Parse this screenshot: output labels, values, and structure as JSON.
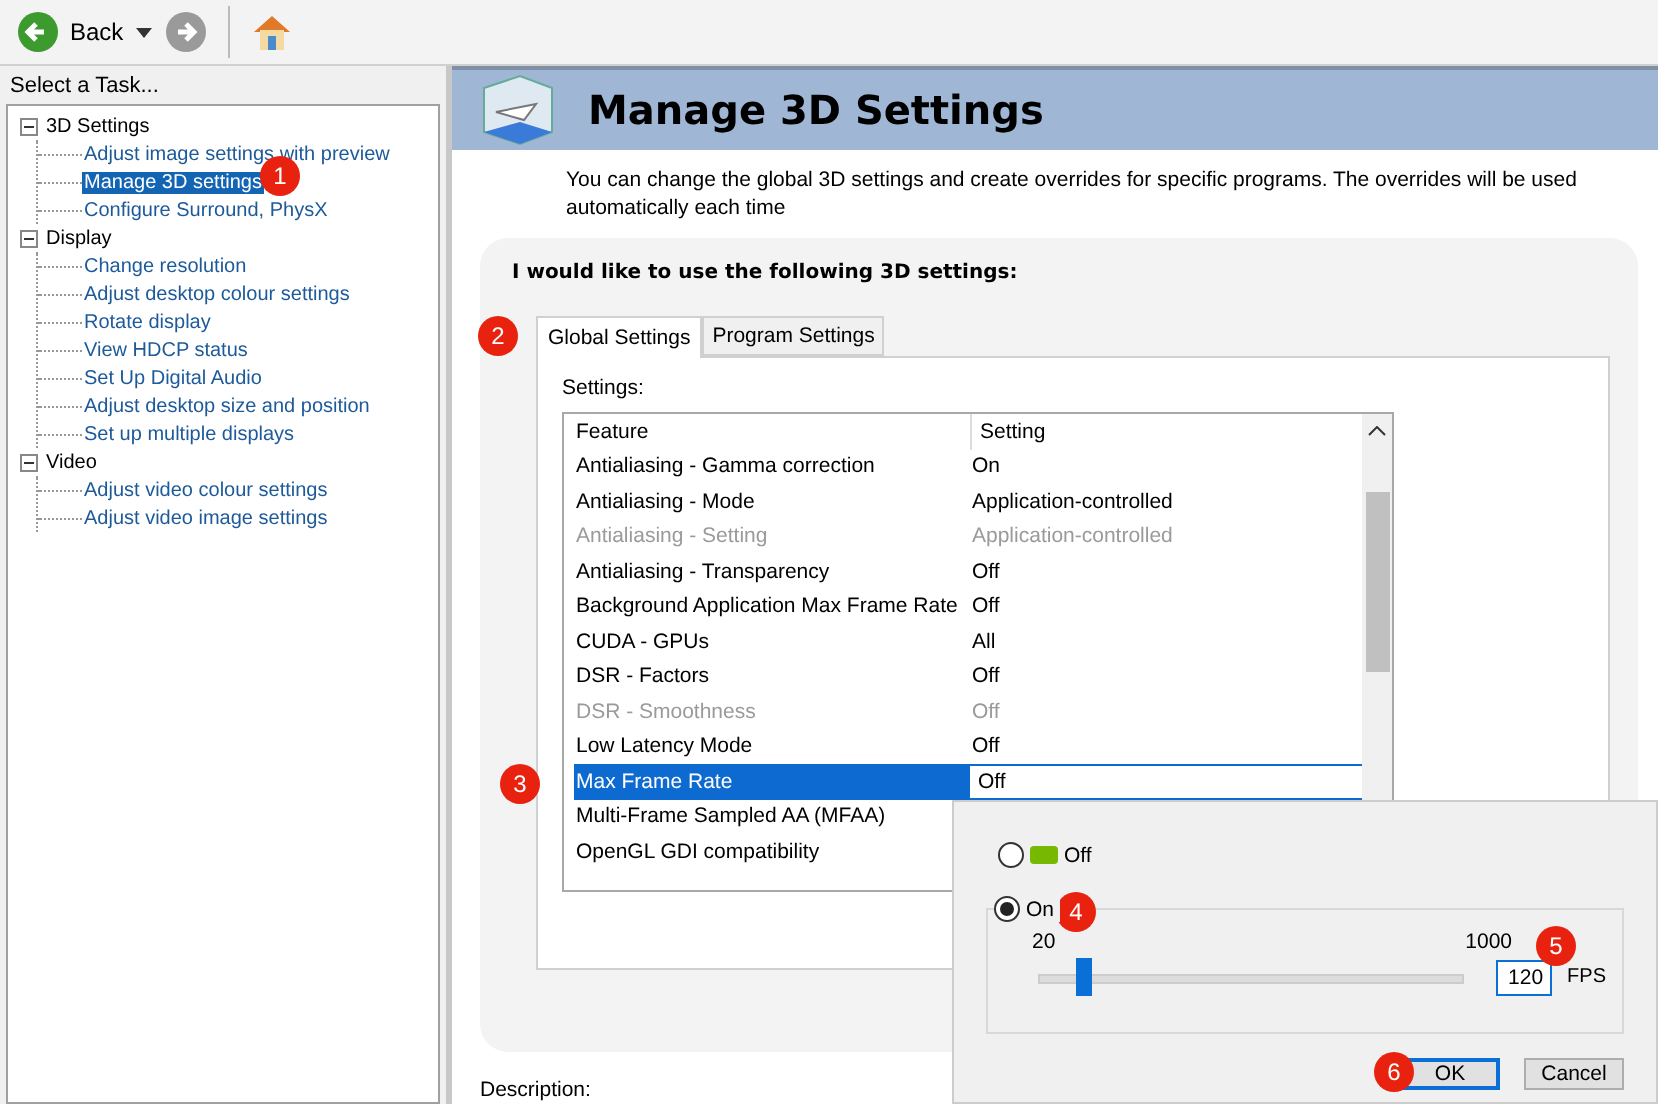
{
  "toolbar": {
    "back_label": "Back"
  },
  "sidebar": {
    "header": "Select a Task...",
    "tree": [
      {
        "label": "3D Settings",
        "expanded": true,
        "children": [
          {
            "label": "Adjust image settings with preview",
            "selected": false
          },
          {
            "label": "Manage 3D settings",
            "selected": true
          },
          {
            "label": "Configure Surround, PhysX",
            "selected": false
          }
        ]
      },
      {
        "label": "Display",
        "expanded": true,
        "children": [
          {
            "label": "Change resolution",
            "selected": false
          },
          {
            "label": "Adjust desktop colour settings",
            "selected": false
          },
          {
            "label": "Rotate display",
            "selected": false
          },
          {
            "label": "View HDCP status",
            "selected": false
          },
          {
            "label": "Set Up Digital Audio",
            "selected": false
          },
          {
            "label": "Adjust desktop size and position",
            "selected": false
          },
          {
            "label": "Set up multiple displays",
            "selected": false
          }
        ]
      },
      {
        "label": "Video",
        "expanded": true,
        "children": [
          {
            "label": "Adjust video colour settings",
            "selected": false
          },
          {
            "label": "Adjust video image settings",
            "selected": false
          }
        ]
      }
    ]
  },
  "page": {
    "title": "Manage 3D Settings",
    "intro": "You can change the global 3D settings and create overrides for specific programs. The overrides will be used automatically each time",
    "heading": "I would like to use the following 3D settings:",
    "tabs": [
      {
        "label": "Global Settings",
        "selected": true
      },
      {
        "label": "Program Settings",
        "selected": false
      }
    ],
    "settings_label": "Settings:",
    "table": {
      "columns": [
        "Feature",
        "Setting"
      ],
      "rows": [
        {
          "feature": "Antialiasing - Gamma correction",
          "setting": "On",
          "disabled": false,
          "selected": false
        },
        {
          "feature": "Antialiasing - Mode",
          "setting": "Application-controlled",
          "disabled": false,
          "selected": false
        },
        {
          "feature": "Antialiasing - Setting",
          "setting": "Application-controlled",
          "disabled": true,
          "selected": false
        },
        {
          "feature": "Antialiasing - Transparency",
          "setting": "Off",
          "disabled": false,
          "selected": false
        },
        {
          "feature": "Background Application Max Frame Rate",
          "setting": "Off",
          "disabled": false,
          "selected": false
        },
        {
          "feature": "CUDA - GPUs",
          "setting": "All",
          "disabled": false,
          "selected": false
        },
        {
          "feature": "DSR - Factors",
          "setting": "Off",
          "disabled": false,
          "selected": false
        },
        {
          "feature": "DSR - Smoothness",
          "setting": "Off",
          "disabled": true,
          "selected": false
        },
        {
          "feature": "Low Latency Mode",
          "setting": "Off",
          "disabled": false,
          "selected": false
        },
        {
          "feature": "Max Frame Rate",
          "setting": "Off",
          "disabled": false,
          "selected": true
        },
        {
          "feature": "Multi-Frame Sampled AA (MFAA)",
          "setting": "",
          "disabled": false,
          "selected": false
        },
        {
          "feature": "OpenGL GDI compatibility",
          "setting": "",
          "disabled": false,
          "selected": false
        }
      ]
    },
    "description_label": "Description:"
  },
  "popup": {
    "options": [
      {
        "label": "Off",
        "selected": false
      },
      {
        "label": "On",
        "selected": true
      }
    ],
    "min_label": "20",
    "max_label": "1000",
    "slider": {
      "level": 0.1
    },
    "fps_value": "120",
    "fps_unit": "FPS",
    "buttons": [
      {
        "label": "OK",
        "default": true
      },
      {
        "label": "Cancel",
        "default": false
      }
    ]
  },
  "callouts": [
    "1",
    "2",
    "3",
    "4",
    "5",
    "6"
  ]
}
